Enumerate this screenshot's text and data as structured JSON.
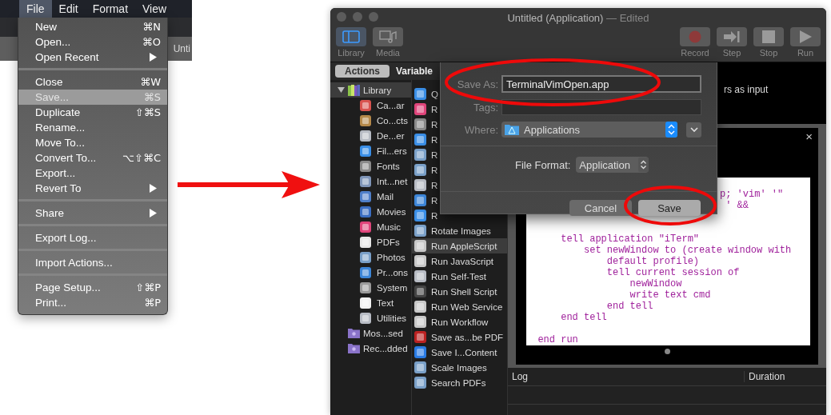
{
  "menu_screenshot": {
    "menubar": [
      {
        "label": "File",
        "selected": true
      },
      {
        "label": "Edit",
        "selected": false
      },
      {
        "label": "Format",
        "selected": false
      },
      {
        "label": "View",
        "selected": false
      }
    ],
    "background_text": "Unti",
    "menu_groups": [
      [
        {
          "label": "New",
          "shortcut": "⌘N",
          "submenu": false,
          "highlighted": false
        },
        {
          "label": "Open...",
          "shortcut": "⌘O",
          "submenu": false,
          "highlighted": false
        },
        {
          "label": "Open Recent",
          "submenu": true,
          "highlighted": false
        }
      ],
      [
        {
          "label": "Close",
          "shortcut": "⌘W",
          "submenu": false,
          "highlighted": false
        },
        {
          "label": "Save...",
          "shortcut": "⌘S",
          "submenu": false,
          "highlighted": true
        },
        {
          "label": "Duplicate",
          "shortcut": "⇧⌘S",
          "submenu": false,
          "highlighted": false
        },
        {
          "label": "Rename...",
          "submenu": false,
          "highlighted": false
        },
        {
          "label": "Move To...",
          "submenu": false,
          "highlighted": false
        },
        {
          "label": "Convert To...",
          "shortcut": "⌥⇧⌘C",
          "submenu": false,
          "highlighted": false
        },
        {
          "label": "Export...",
          "submenu": false,
          "highlighted": false
        },
        {
          "label": "Revert To",
          "submenu": true,
          "highlighted": false
        }
      ],
      [
        {
          "label": "Share",
          "submenu": true,
          "highlighted": false
        }
      ],
      [
        {
          "label": "Export Log...",
          "submenu": false,
          "highlighted": false
        }
      ],
      [
        {
          "label": "Import Actions...",
          "submenu": false,
          "highlighted": false
        }
      ],
      [
        {
          "label": "Page Setup...",
          "shortcut": "⇧⌘P",
          "submenu": false,
          "highlighted": false
        },
        {
          "label": "Print...",
          "shortcut": "⌘P",
          "submenu": false,
          "highlighted": false
        }
      ]
    ]
  },
  "window": {
    "title": "Untitled (Application)",
    "title_status": "— Edited",
    "toolbar_left": [
      {
        "label": "Library",
        "kind": "library",
        "selected": true
      },
      {
        "label": "Media",
        "kind": "media",
        "selected": false
      }
    ],
    "toolbar_right": [
      {
        "label": "Record",
        "kind": "record"
      },
      {
        "label": "Step",
        "kind": "step"
      },
      {
        "label": "Stop",
        "kind": "stop"
      },
      {
        "label": "Run",
        "kind": "run"
      }
    ],
    "pane_tabs": [
      {
        "label": "Actions",
        "selected": true
      },
      {
        "label": "Variable",
        "selected": false
      }
    ],
    "library_tree": [
      {
        "label": "Library",
        "kind": "library",
        "selected": true,
        "expanded": true,
        "children": [
          {
            "label": "Ca...ar",
            "selected": false
          },
          {
            "label": "Co...cts",
            "selected": false
          },
          {
            "label": "De...er",
            "selected": false
          },
          {
            "label": "Fil...ers",
            "selected": false
          },
          {
            "label": "Fonts",
            "selected": false
          },
          {
            "label": "Int...net",
            "selected": false
          },
          {
            "label": "Mail",
            "selected": false
          },
          {
            "label": "Movies",
            "selected": false
          },
          {
            "label": "Music",
            "selected": false
          },
          {
            "label": "PDFs",
            "selected": false
          },
          {
            "label": "Photos",
            "selected": false
          },
          {
            "label": "Pr...ons",
            "selected": false
          },
          {
            "label": "System",
            "selected": false
          },
          {
            "label": "Text",
            "selected": false
          },
          {
            "label": "Utilities",
            "selected": false
          }
        ]
      },
      {
        "label": "Mos...sed",
        "kind": "folder",
        "selected": false
      },
      {
        "label": "Rec...dded",
        "kind": "folder",
        "selected": false
      }
    ],
    "actions": [
      {
        "label": "Q",
        "selected": false
      },
      {
        "label": "R",
        "selected": false
      },
      {
        "label": "R",
        "selected": false
      },
      {
        "label": "R",
        "selected": false
      },
      {
        "label": "R",
        "selected": false
      },
      {
        "label": "R",
        "selected": false
      },
      {
        "label": "R",
        "selected": false
      },
      {
        "label": "R",
        "selected": false
      },
      {
        "label": "R",
        "selected": false
      },
      {
        "label": "Rotate Images",
        "selected": false
      },
      {
        "label": "Run AppleScript",
        "selected": true
      },
      {
        "label": "Run JavaScript",
        "selected": false
      },
      {
        "label": "Run Self-Test",
        "selected": false
      },
      {
        "label": "Run Shell Script",
        "selected": false
      },
      {
        "label": "Run Web Service",
        "selected": false
      },
      {
        "label": "Run Workflow",
        "selected": false
      },
      {
        "label": "Save as...be PDF",
        "selected": false
      },
      {
        "label": "Save I...Content",
        "selected": false
      },
      {
        "label": "Scale Images",
        "selected": false
      },
      {
        "label": "Search PDFs",
        "selected": false
      }
    ],
    "description": "rs as input",
    "action_card": {
      "close": "×",
      "code_blocks": [
        {
          "kind": "fragment",
          "lines": [
            "p; 'vim' '\"",
            " ' &&"
          ]
        },
        {
          "kind": "code",
          "lines": [
            "      tell application \"iTerm\"",
            "          set newWindow to (create window with",
            "              default profile)",
            "              tell current session of",
            "                  newWindow",
            "                  write text cmd",
            "              end tell",
            "      end tell"
          ]
        },
        {
          "kind": "code",
          "lines": [
            "  end run"
          ]
        }
      ]
    },
    "log": {
      "columns": [
        "Log",
        "Duration"
      ]
    },
    "save_sheet": {
      "save_as_label": "Save As:",
      "filename": "TerminalVimOpen.app",
      "tags_label": "Tags:",
      "where_label": "Where:",
      "where_value": "Applications",
      "format_label": "File Format:",
      "format_value": "Application",
      "buttons": [
        {
          "label": "Cancel",
          "default": false
        },
        {
          "label": "Save",
          "default": true
        }
      ]
    }
  }
}
